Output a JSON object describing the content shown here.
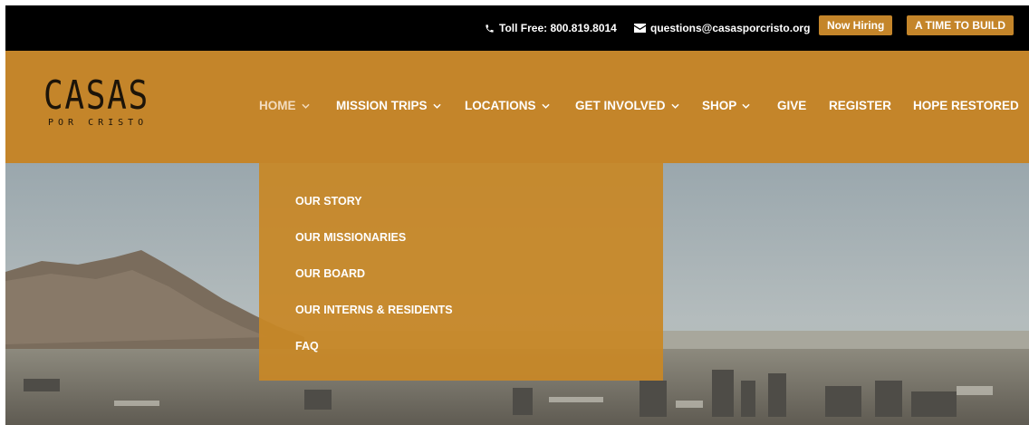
{
  "topbar": {
    "phone_icon": "phone-icon",
    "phone_text": "Toll Free: 800.819.8014",
    "email_icon": "envelope-icon",
    "email_text": "questions@casasporcristo.org",
    "hiring_label": "Now Hiring",
    "build_label": "A TIME TO BUILD"
  },
  "logo": {
    "line1": "CASAS",
    "line2": "POR CRISTO"
  },
  "nav": {
    "items": [
      {
        "label": "HOME",
        "has_dropdown": true
      },
      {
        "label": "MISSION TRIPS",
        "has_dropdown": true
      },
      {
        "label": "LOCATIONS",
        "has_dropdown": true
      },
      {
        "label": "GET INVOLVED",
        "has_dropdown": true
      },
      {
        "label": "SHOP",
        "has_dropdown": true
      },
      {
        "label": "GIVE",
        "has_dropdown": false
      },
      {
        "label": "REGISTER",
        "has_dropdown": false
      },
      {
        "label": "HOPE RESTORED",
        "has_dropdown": false
      }
    ]
  },
  "dropdown": {
    "items": [
      "OUR STORY",
      "OUR MISSIONARIES",
      "OUR BOARD",
      "OUR INTERNS & RESIDENTS",
      "FAQ"
    ]
  },
  "colors": {
    "accent": "#c4852a",
    "topbar": "#000000",
    "nav_active": "#f3dcbf"
  }
}
